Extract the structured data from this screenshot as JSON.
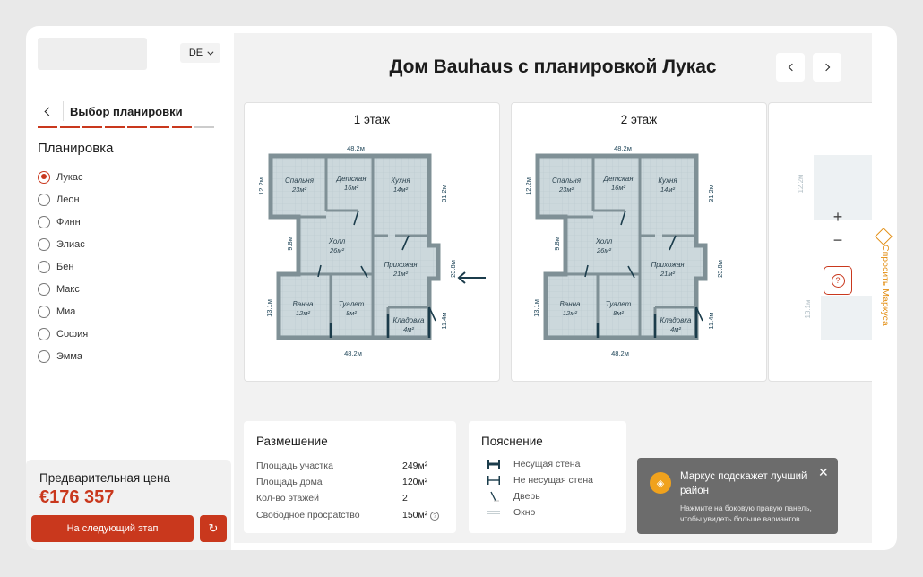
{
  "sidebar": {
    "lang": "DE",
    "back_title": "Выбор планировки",
    "section_title": "Планировка",
    "layouts": [
      "Лукас",
      "Леон",
      "Финн",
      "Элиас",
      "Бен",
      "Макс",
      "Миа",
      "София",
      "Эмма"
    ],
    "selected_layout": "Лукас",
    "price_label": "Предварительная цена",
    "price_value": "€176 357",
    "next_button": "На  следующий этап"
  },
  "main": {
    "title": "Дом Bauhaus с планировкой Лукас",
    "floors": [
      {
        "title": "1 этаж"
      },
      {
        "title": "2 этаж"
      }
    ],
    "plan": {
      "dims": {
        "top": "48.2м",
        "bottom": "48.2м",
        "left_top": "12.2м",
        "left_mid": "9.8м",
        "left_bottom": "13.1м",
        "right_top": "31.2м",
        "right_mid": "23.8м",
        "right_bottom": "11.4м"
      },
      "rooms": [
        {
          "name": "Спальня",
          "area": "23м²"
        },
        {
          "name": "Детская",
          "area": "16м²"
        },
        {
          "name": "Кухня",
          "area": "14м²"
        },
        {
          "name": "Холл",
          "area": "26м²"
        },
        {
          "name": "Прихожая",
          "area": "21м²"
        },
        {
          "name": "Ванна",
          "area": "12м²"
        },
        {
          "name": "Туалет",
          "area": "8м²"
        },
        {
          "name": "Кладовка",
          "area": "4м²"
        }
      ]
    },
    "peek_dims": {
      "a": "12.2м",
      "b": "13.1м"
    },
    "zoom_in": "+",
    "zoom_out": "−"
  },
  "placement": {
    "title": "Размешение",
    "rows": [
      {
        "label": "Площадь участка",
        "value": "249м²"
      },
      {
        "label": "Площадь дома",
        "value": "120м²"
      },
      {
        "label": "Кол-во этажей",
        "value": "2"
      },
      {
        "label": "Свободное просрatство",
        "value": "150м²"
      }
    ]
  },
  "legend": {
    "title": "Пояснение",
    "items": [
      "Несущая стена",
      "Не несущая стена",
      "Дверь",
      "Окно"
    ]
  },
  "toast": {
    "title": "Маркус подскажет лучший район",
    "text": "Нажмите на боковую правую панель, чтобы увидеть больше вариантов"
  },
  "ask_label": "Спросить Маркуса",
  "colors": {
    "accent": "#c9381d",
    "wall": "#7f9096",
    "floor": "#ccd8dc",
    "assistant": "#e38e12"
  }
}
